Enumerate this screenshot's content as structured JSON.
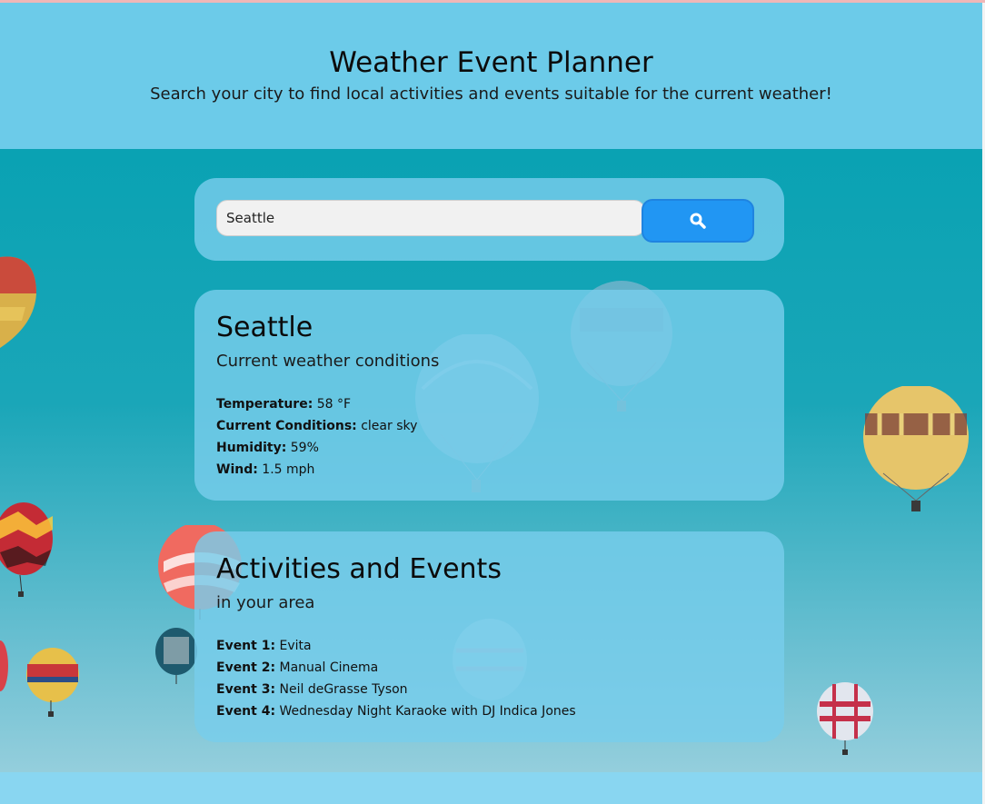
{
  "header": {
    "title": "Weather Event Planner",
    "subtitle": "Search your city to find local activities and events suitable for the current weather!"
  },
  "search": {
    "value": "Seattle",
    "button_icon": "search-icon"
  },
  "weather": {
    "city": "Seattle",
    "subtitle": "Current weather conditions",
    "rows": [
      {
        "label": "Temperature:",
        "value": "58 °F"
      },
      {
        "label": "Current Conditions:",
        "value": "clear sky"
      },
      {
        "label": "Humidity:",
        "value": "59%"
      },
      {
        "label": "Wind:",
        "value": "1.5 mph"
      }
    ]
  },
  "events": {
    "title": "Activities and Events",
    "subtitle": "in your area",
    "items": [
      {
        "label": "Event 1:",
        "value": "Evita"
      },
      {
        "label": "Event 2:",
        "value": "Manual Cinema"
      },
      {
        "label": "Event 3:",
        "value": "Neil deGrasse Tyson"
      },
      {
        "label": "Event 4:",
        "value": "Wednesday Night Karaoke with DJ Indica Jones"
      }
    ]
  },
  "colors": {
    "header_bg": "#6ccbe9",
    "card_bg": "#78cdeb",
    "button_bg": "#2196f3",
    "sky_top": "#00a0b0"
  }
}
